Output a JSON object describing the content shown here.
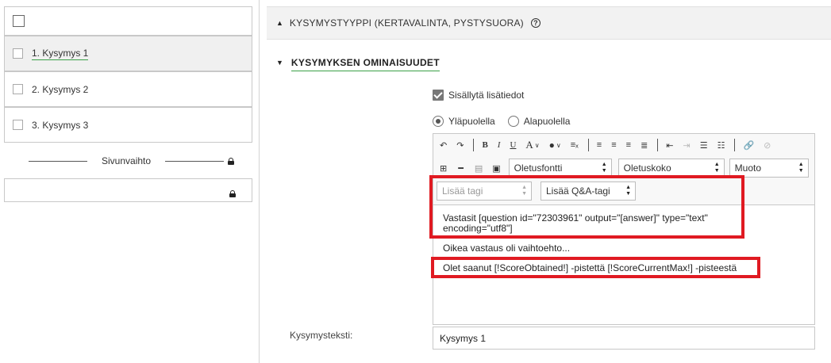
{
  "sidebar": {
    "questions": [
      {
        "label": "1.  Kysymys 1",
        "active": true
      },
      {
        "label": "2.  Kysymys 2",
        "active": false
      },
      {
        "label": "3.  Kysymys 3",
        "active": false
      }
    ],
    "page_break_label": "Sivunvaihto"
  },
  "sections": {
    "question_type": "KYSYMYSTYYPPI (KERTAVALINTA, PYSTYSUORA)",
    "question_properties": "KYSYMYKSEN OMINAISUUDET"
  },
  "include_info": {
    "label": "Sisällytä lisätiedot",
    "checked": true
  },
  "position": {
    "options": [
      "Yläpuolella",
      "Alapuolella"
    ],
    "selected": "Yläpuolella"
  },
  "toolbar": {
    "font": "Oletusfontti",
    "size": "Oletuskoko",
    "format": "Muoto",
    "add_tag": "Lisää tagi",
    "add_qa_tag": "Lisää Q&A-tagi",
    "bold": "B",
    "italic": "I",
    "underline": "U",
    "font_color": "A"
  },
  "editor_content": {
    "line1": "Vastasit [question id=\"72303961\" output=\"[answer]\" type=\"text\" encoding=\"utf8\"]",
    "line2": "Oikea vastaus oli vaihtoehto...",
    "line3": "Olet saanut [!ScoreObtained!] -pistettä [!ScoreCurrentMax!] -pisteestä"
  },
  "question_text": {
    "label": "Kysymysteksti:",
    "value": "Kysymys 1"
  },
  "colors": {
    "accent_green": "#3aa047",
    "highlight_red": "#e01a22"
  }
}
